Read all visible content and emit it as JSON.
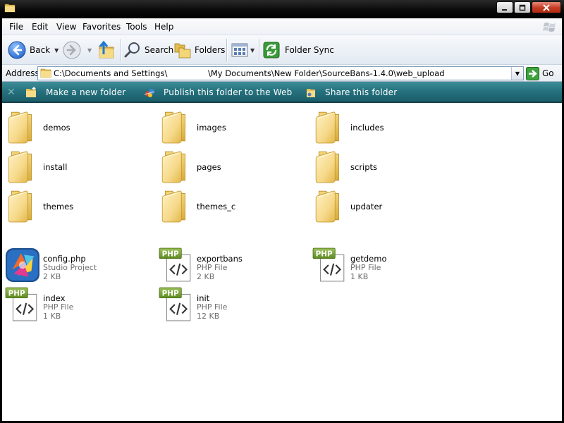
{
  "menu": [
    "File",
    "Edit",
    "View",
    "Favorites",
    "Tools",
    "Help"
  ],
  "toolbar": {
    "back": "Back",
    "search": "Search",
    "folders": "Folders",
    "folder_sync": "Folder Sync"
  },
  "address": {
    "label": "Address",
    "path_part1": "C:\\Documents and Settings\\",
    "path_part2": "\\My Documents\\New Folder\\SourceBans-1.4.0\\web_upload",
    "go": "Go"
  },
  "tasks": {
    "new_folder": "Make a new folder",
    "publish": "Publish this folder to the Web",
    "share": "Share this folder"
  },
  "folders": [
    {
      "name": "demos"
    },
    {
      "name": "images"
    },
    {
      "name": "includes"
    },
    {
      "name": "install"
    },
    {
      "name": "pages"
    },
    {
      "name": "scripts"
    },
    {
      "name": "themes"
    },
    {
      "name": "themes_c"
    },
    {
      "name": "updater"
    }
  ],
  "files": [
    {
      "name": "config.php",
      "type": "Studio Project",
      "size": "2 KB",
      "icon": "studio-project-icon"
    },
    {
      "name": "exportbans",
      "type": "PHP File",
      "size": "2 KB",
      "icon": "php-file-icon"
    },
    {
      "name": "getdemo",
      "type": "PHP File",
      "size": "1 KB",
      "icon": "php-file-icon"
    },
    {
      "name": "index",
      "type": "PHP File",
      "size": "1 KB",
      "icon": "php-file-icon"
    },
    {
      "name": "init",
      "type": "PHP File",
      "size": "12 KB",
      "icon": "php-file-icon"
    }
  ],
  "php_badge": "PHP"
}
